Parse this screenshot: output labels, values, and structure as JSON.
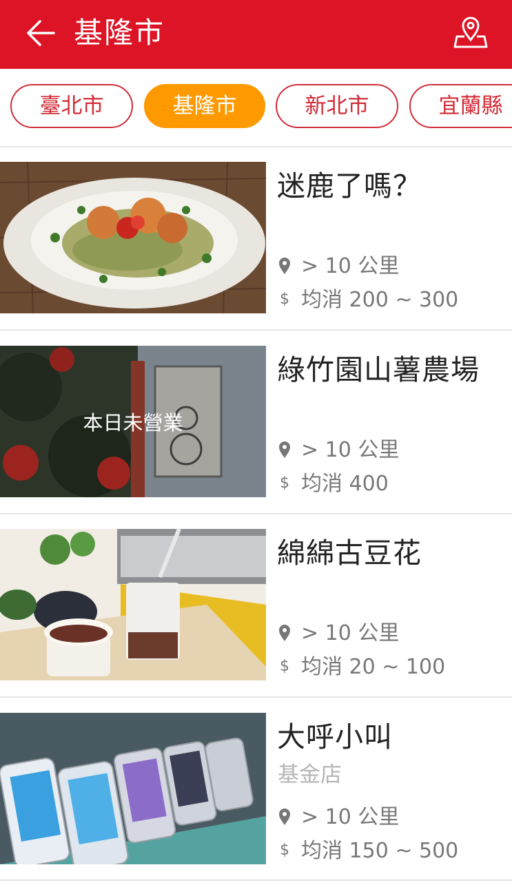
{
  "header": {
    "title": "基隆市",
    "back_icon": "back-arrow-icon",
    "map_icon": "map-pin-icon",
    "bg_color": "#dc1426"
  },
  "city_tabs": [
    {
      "label": "臺北市",
      "active": false
    },
    {
      "label": "基隆市",
      "active": true
    },
    {
      "label": "新北市",
      "active": false
    },
    {
      "label": "宜蘭縣",
      "active": false
    }
  ],
  "accent_color": "#ff9900",
  "shops": [
    {
      "name": "迷鹿了嗎？",
      "branch": "",
      "distance": "> 10 公里",
      "price": "均消 200 ~ 300",
      "closed_label": ""
    },
    {
      "name": "綠竹園山薯農場",
      "branch": "",
      "distance": "> 10 公里",
      "price": "均消 400",
      "closed_label": "本日未營業"
    },
    {
      "name": "綿綿古豆花",
      "branch": "",
      "distance": "> 10 公里",
      "price": "均消 20 ~ 100",
      "closed_label": ""
    },
    {
      "name": "大呼小叫",
      "branch": "基金店",
      "distance": "> 10 公里",
      "price": "均消 150 ~ 500",
      "closed_label": ""
    }
  ],
  "icons": {
    "distance": "location-pin-icon",
    "price": "dollar-icon"
  },
  "price_symbol": "$"
}
